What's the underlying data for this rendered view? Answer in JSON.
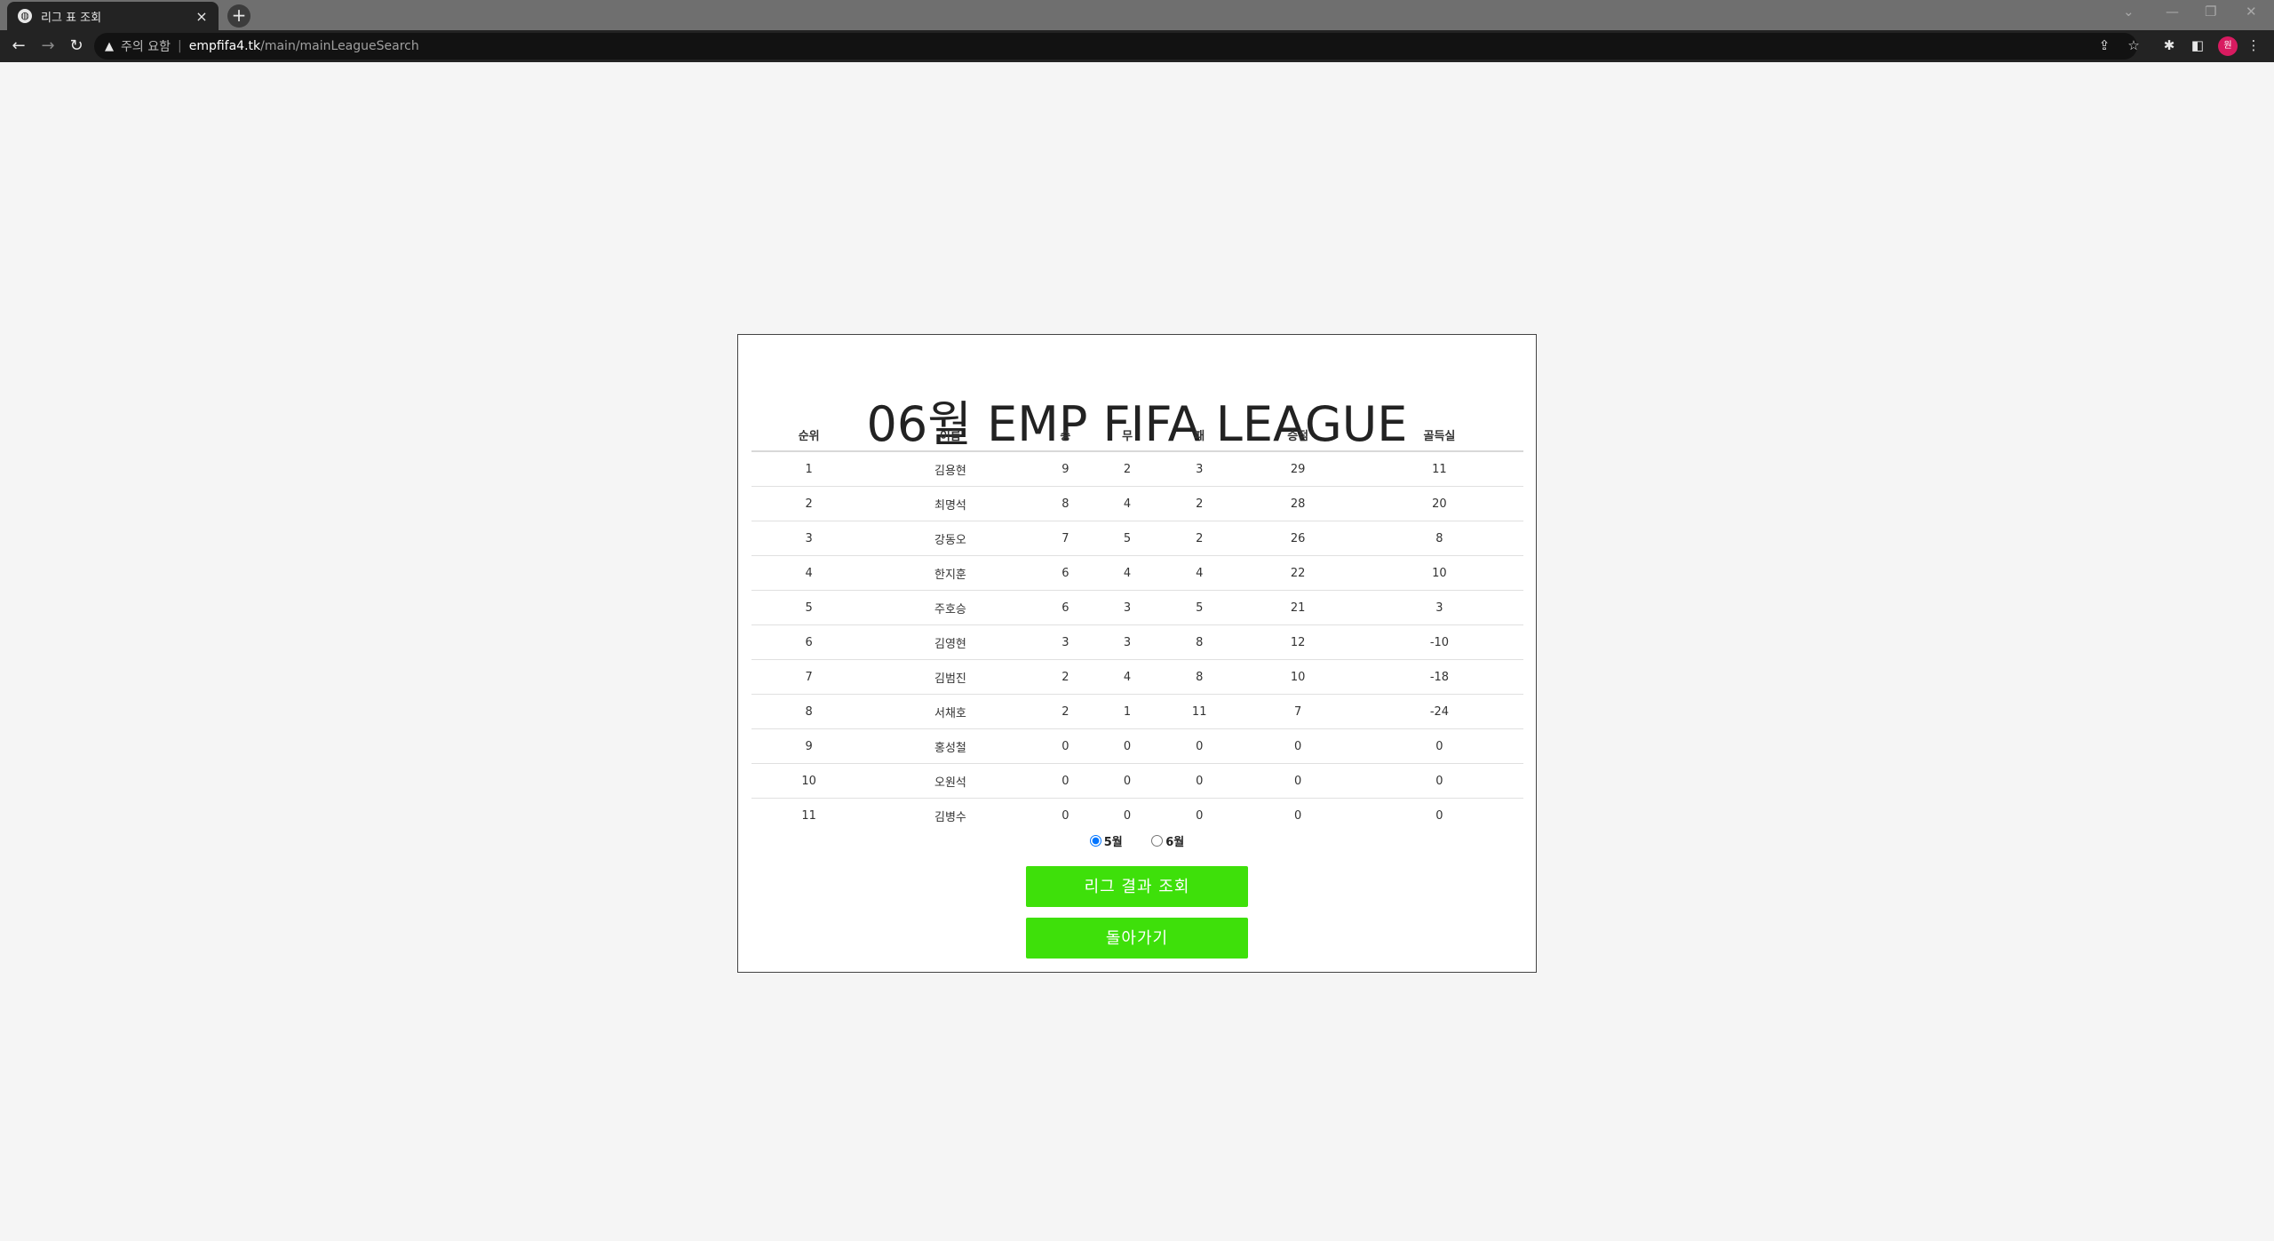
{
  "browser": {
    "tab_title": "리그 표 조회",
    "tab_close": "×",
    "new_tab": "+",
    "warning_icon": "▲",
    "warning_text": "주의 요함",
    "separator": "|",
    "url_host": "empfifa4.tk",
    "url_path": "/main/mainLeagueSearch",
    "avatar_initial": "원"
  },
  "page": {
    "title": "06월 EMP FIFA LEAGUE",
    "table": {
      "headers": [
        "순위",
        "이름",
        "승",
        "무",
        "패",
        "승점",
        "골득실"
      ],
      "rows": [
        [
          "1",
          "김용현",
          "9",
          "2",
          "3",
          "29",
          "11"
        ],
        [
          "2",
          "최명석",
          "8",
          "4",
          "2",
          "28",
          "20"
        ],
        [
          "3",
          "강동오",
          "7",
          "5",
          "2",
          "26",
          "8"
        ],
        [
          "4",
          "한지훈",
          "6",
          "4",
          "4",
          "22",
          "10"
        ],
        [
          "5",
          "주호승",
          "6",
          "3",
          "5",
          "21",
          "3"
        ],
        [
          "6",
          "김영현",
          "3",
          "3",
          "8",
          "12",
          "-10"
        ],
        [
          "7",
          "김범진",
          "2",
          "4",
          "8",
          "10",
          "-18"
        ],
        [
          "8",
          "서채호",
          "2",
          "1",
          "11",
          "7",
          "-24"
        ],
        [
          "9",
          "홍성철",
          "0",
          "0",
          "0",
          "0",
          "0"
        ],
        [
          "10",
          "오원석",
          "0",
          "0",
          "0",
          "0",
          "0"
        ],
        [
          "11",
          "김병수",
          "0",
          "0",
          "0",
          "0",
          "0"
        ]
      ]
    },
    "month_options": [
      {
        "label": "5월",
        "checked": true
      },
      {
        "label": "6월",
        "checked": false
      }
    ],
    "search_button": "리그 결과 조회",
    "back_button": "돌아가기",
    "button_color": "#3ee00a"
  }
}
